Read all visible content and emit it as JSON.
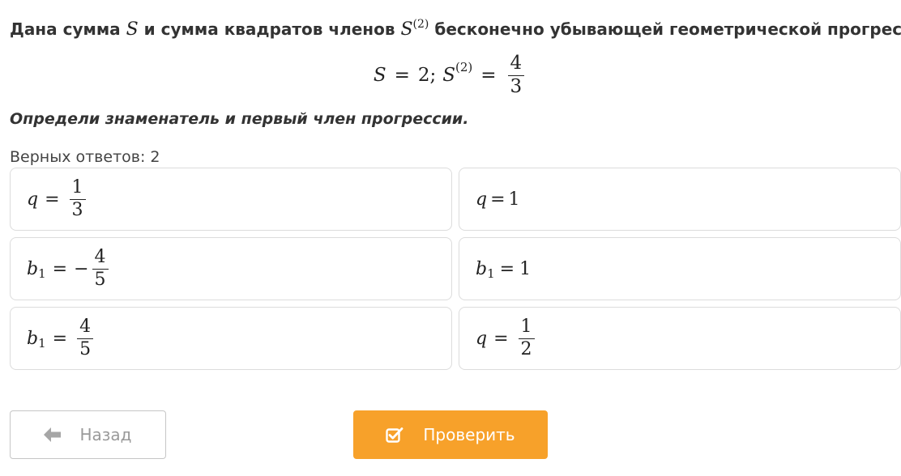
{
  "problem": {
    "text_part1": "Дана сумма ",
    "var_S": "S",
    "text_part2": " и сумма квадратов членов ",
    "var_S2": "S",
    "sup_2": "(2)",
    "text_part3": " бесконечно убывающей геометрической прогрессии:"
  },
  "formula": {
    "S": "S",
    "eq1": "=",
    "val1": "2;",
    "S2": "S",
    "sup": "(2)",
    "eq2": "=",
    "num": "4",
    "den": "3"
  },
  "instruction": "Определи знаменатель и первый член прогрессии.",
  "answers_count": "Верных ответов: 2",
  "options": [
    {
      "var": "q",
      "sub": "",
      "op": "=",
      "sign": "",
      "num": "1",
      "den": "3"
    },
    {
      "var": "q",
      "sub": "",
      "op": "=",
      "value": "1"
    },
    {
      "var": "b",
      "sub": "1",
      "op": "=",
      "sign": "−",
      "num": "4",
      "den": "5"
    },
    {
      "var": "b",
      "sub": "1",
      "op": "=",
      "value": "1"
    },
    {
      "var": "b",
      "sub": "1",
      "op": "=",
      "sign": "",
      "num": "4",
      "den": "5"
    },
    {
      "var": "q",
      "sub": "",
      "op": "=",
      "sign": "",
      "num": "1",
      "den": "2"
    }
  ],
  "buttons": {
    "back_label": "Назад",
    "back_icon": "arrow-left-icon",
    "check_label": "Проверить",
    "check_icon": "checkbox-check-icon"
  },
  "colors": {
    "accent": "#f7a12a",
    "border": "#dcdcdc",
    "text": "#333333"
  }
}
